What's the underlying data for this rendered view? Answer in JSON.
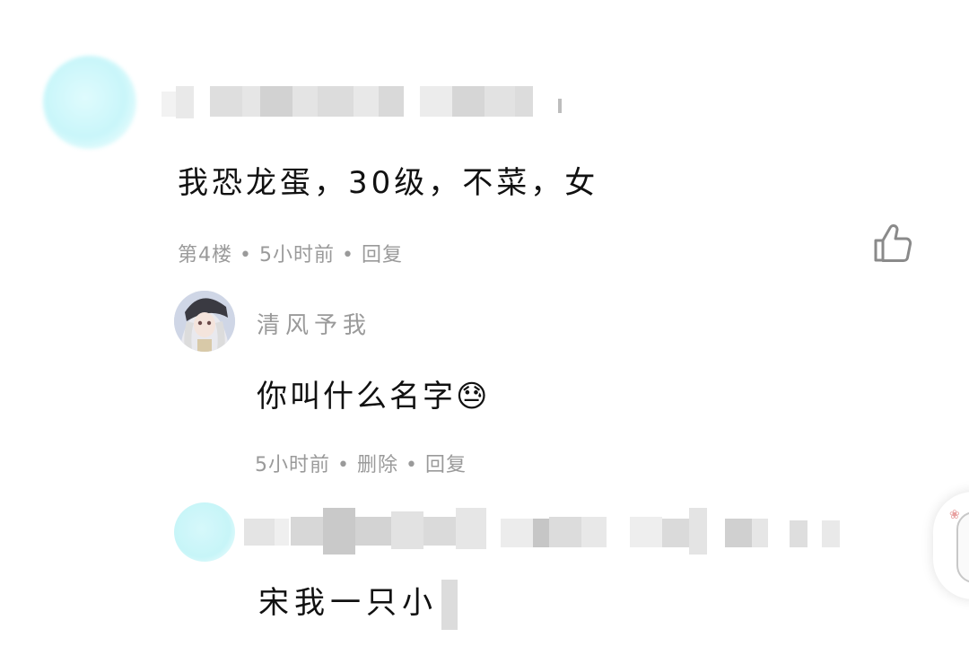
{
  "comment1": {
    "text": "我恐龙蛋，30级，不菜，女",
    "floor": "第4楼",
    "time": "5小时前",
    "reply_label": "回复"
  },
  "reply": {
    "username": "清风予我",
    "text": "你叫什么名字😓",
    "time": "5小时前",
    "delete_label": "删除",
    "reply_label": "回复"
  },
  "comment2": {
    "text": "宋我一只小"
  },
  "icons": {
    "like": "thumbs-up-icon",
    "float": "floating-action-icon"
  },
  "colors": {
    "meta_gray": "#9a9a9a",
    "avatar_blur": "#c9f6fa"
  }
}
